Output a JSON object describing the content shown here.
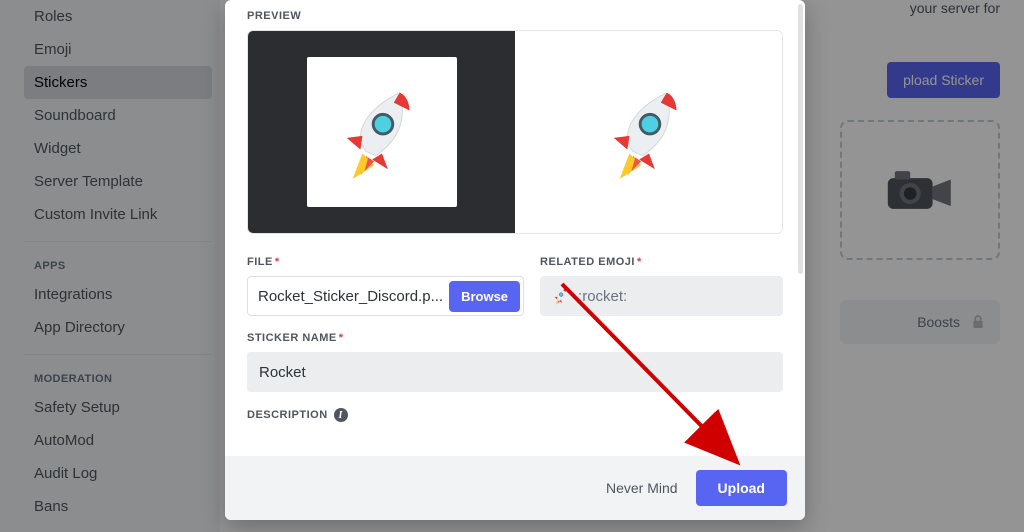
{
  "sidebar": {
    "items": [
      {
        "label": "Roles"
      },
      {
        "label": "Emoji"
      },
      {
        "label": "Stickers"
      },
      {
        "label": "Soundboard"
      },
      {
        "label": "Widget"
      },
      {
        "label": "Server Template"
      },
      {
        "label": "Custom Invite Link"
      }
    ],
    "apps_heading": "Apps",
    "apps": [
      {
        "label": "Integrations"
      },
      {
        "label": "App Directory"
      }
    ],
    "moderation_heading": "Moderation",
    "moderation": [
      {
        "label": "Safety Setup"
      },
      {
        "label": "AutoMod"
      },
      {
        "label": "Audit Log"
      },
      {
        "label": "Bans"
      }
    ]
  },
  "content": {
    "blurb_tail": "your server for",
    "upload_button": "pload Sticker",
    "boosts_label": "Boosts"
  },
  "modal": {
    "preview_label": "Preview",
    "file_label": "File",
    "file_name": "Rocket_Sticker_Discord.p...",
    "browse_label": "Browse",
    "emoji_label": "Related Emoji",
    "emoji_shortcode": ":rocket:",
    "name_label": "Sticker Name",
    "name_value": "Rocket",
    "desc_label": "Description",
    "never_mind": "Never Mind",
    "upload": "Upload"
  },
  "icons": {
    "info_glyph": "i"
  }
}
